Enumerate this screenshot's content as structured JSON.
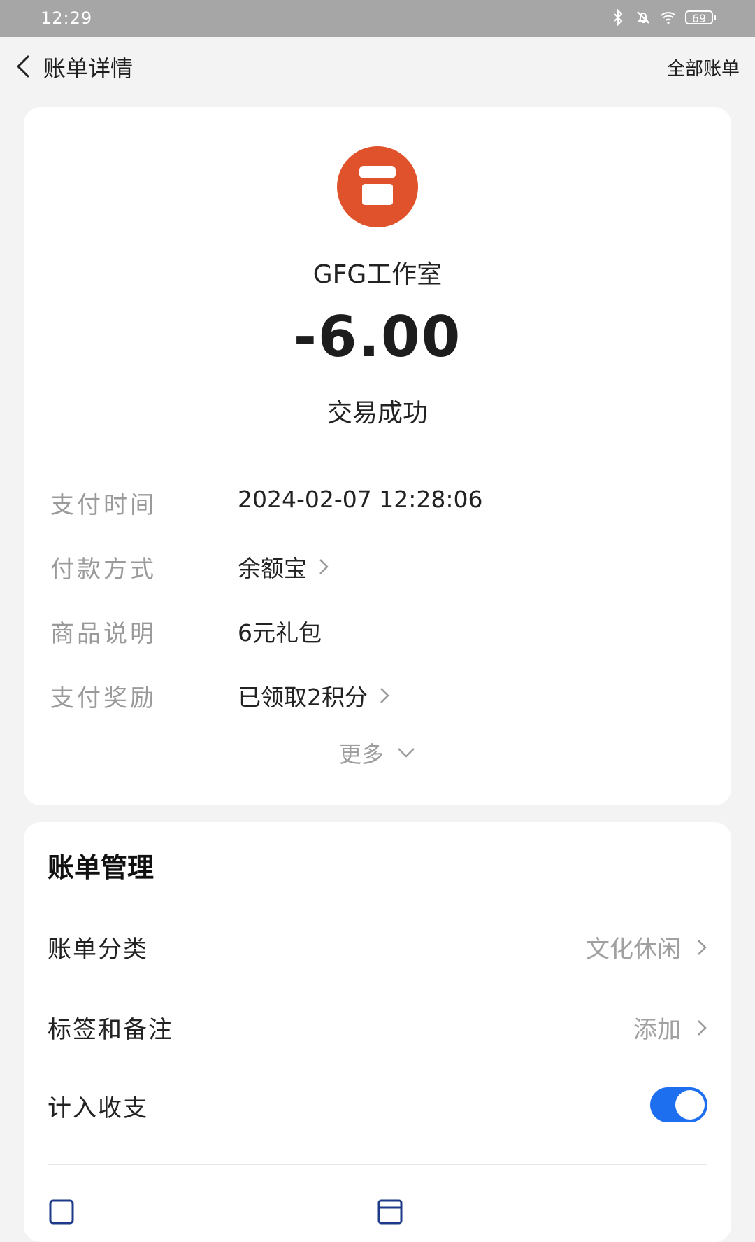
{
  "status_bar": {
    "time": "12:29",
    "battery": "69"
  },
  "nav": {
    "title": "账单详情",
    "right_link": "全部账单"
  },
  "merchant": {
    "name": "GFG工作室",
    "logo_color": "#e0522b"
  },
  "transaction": {
    "amount": "-6.00",
    "status": "交易成功"
  },
  "details": [
    {
      "label": "支付时间",
      "value": "2024-02-07 12:28:06"
    },
    {
      "label": "付款方式",
      "value": "余额宝"
    },
    {
      "label": "商品说明",
      "value": "6元礼包"
    },
    {
      "label": "支付奖励",
      "value": "已领取2积分"
    }
  ],
  "more_label": "更多",
  "management": {
    "title": "账单管理",
    "category_label": "账单分类",
    "category_value": "文化休闲",
    "tags_label": "标签和备注",
    "tags_value": "添加",
    "include_label": "计入收支",
    "include_enabled": true,
    "accent_color": "#1e6ff0"
  }
}
